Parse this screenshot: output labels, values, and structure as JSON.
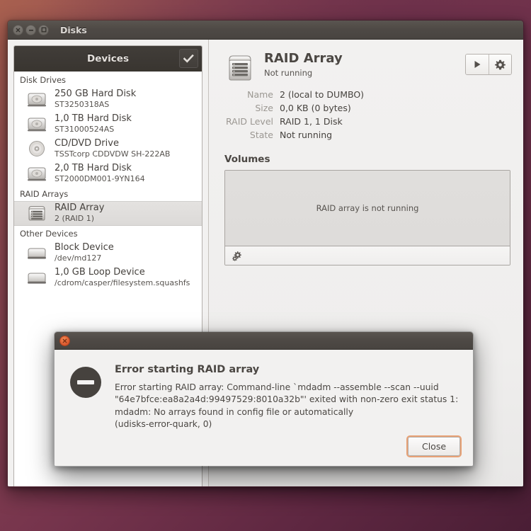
{
  "window": {
    "title": "Disks",
    "buttons": [
      {
        "name": "close",
        "glyph": "close-icon"
      },
      {
        "name": "minimize",
        "glyph": "minimize-icon"
      },
      {
        "name": "maximize",
        "glyph": "maximize-icon"
      }
    ]
  },
  "sidebar": {
    "header_title": "Devices",
    "check_icon": "checkmark-icon",
    "groups": [
      {
        "label": "Disk Drives",
        "items": [
          {
            "icon": "hard-disk-icon",
            "name": "250 GB Hard Disk",
            "sub": "ST3250318AS",
            "selected": false
          },
          {
            "icon": "hard-disk-icon",
            "name": "1,0 TB Hard Disk",
            "sub": "ST31000524AS",
            "selected": false
          },
          {
            "icon": "optical-disc-icon",
            "name": "CD/DVD Drive",
            "sub": "TSSTcorp CDDVDW SH-222AB",
            "selected": false
          },
          {
            "icon": "hard-disk-icon",
            "name": "2,0 TB Hard Disk",
            "sub": "ST2000DM001-9YN164",
            "selected": false
          }
        ]
      },
      {
        "label": "RAID Arrays",
        "items": [
          {
            "icon": "raid-array-icon",
            "name": "RAID Array",
            "sub": "2 (RAID 1)",
            "selected": true
          }
        ]
      },
      {
        "label": "Other Devices",
        "items": [
          {
            "icon": "block-device-icon",
            "name": "Block Device",
            "sub": "/dev/md127",
            "selected": false
          },
          {
            "icon": "block-device-icon",
            "name": "1,0 GB Loop Device",
            "sub": "/cdrom/casper/filesystem.squashfs",
            "selected": false
          }
        ]
      }
    ]
  },
  "detail": {
    "icon": "raid-array-icon",
    "title": "RAID Array",
    "subtitle": "Not running",
    "toolbar": [
      {
        "name": "start-array-button",
        "icon": "play-icon"
      },
      {
        "name": "array-options-button",
        "icon": "gear-icon"
      }
    ],
    "info": [
      {
        "key": "Name",
        "value": "2 (local to DUMBO)"
      },
      {
        "key": "Size",
        "value": "0,0 KB (0 bytes)"
      },
      {
        "key": "RAID Level",
        "value": "RAID 1, 1 Disk"
      },
      {
        "key": "State",
        "value": "Not running"
      }
    ]
  },
  "volumes": {
    "label": "Volumes",
    "empty_text": "RAID array is not running",
    "toolbar_icon": "gears-icon"
  },
  "dialog": {
    "close_dot_icon": "close-icon",
    "severity_icon": "error-minus-icon",
    "heading": "Error starting RAID array",
    "message": "Error starting RAID array: Command-line `mdadm --assemble  --scan --uuid \"64e7bfce:ea8a2a4d:99497529:8010a32b\"' exited with non-zero exit status 1: mdadm: No arrays found in config file or automatically\n (udisks-error-quark, 0)",
    "close_label": "Close"
  },
  "colors": {
    "titlebar": "#4e4945",
    "desktop": "#77354d",
    "accent_orange": "#d9552c",
    "focus_ring": "#e8a175",
    "panel_bg": "#f2f1f0",
    "sidebar_bg": "#ffffff",
    "devices_header_bg": "#393530"
  }
}
